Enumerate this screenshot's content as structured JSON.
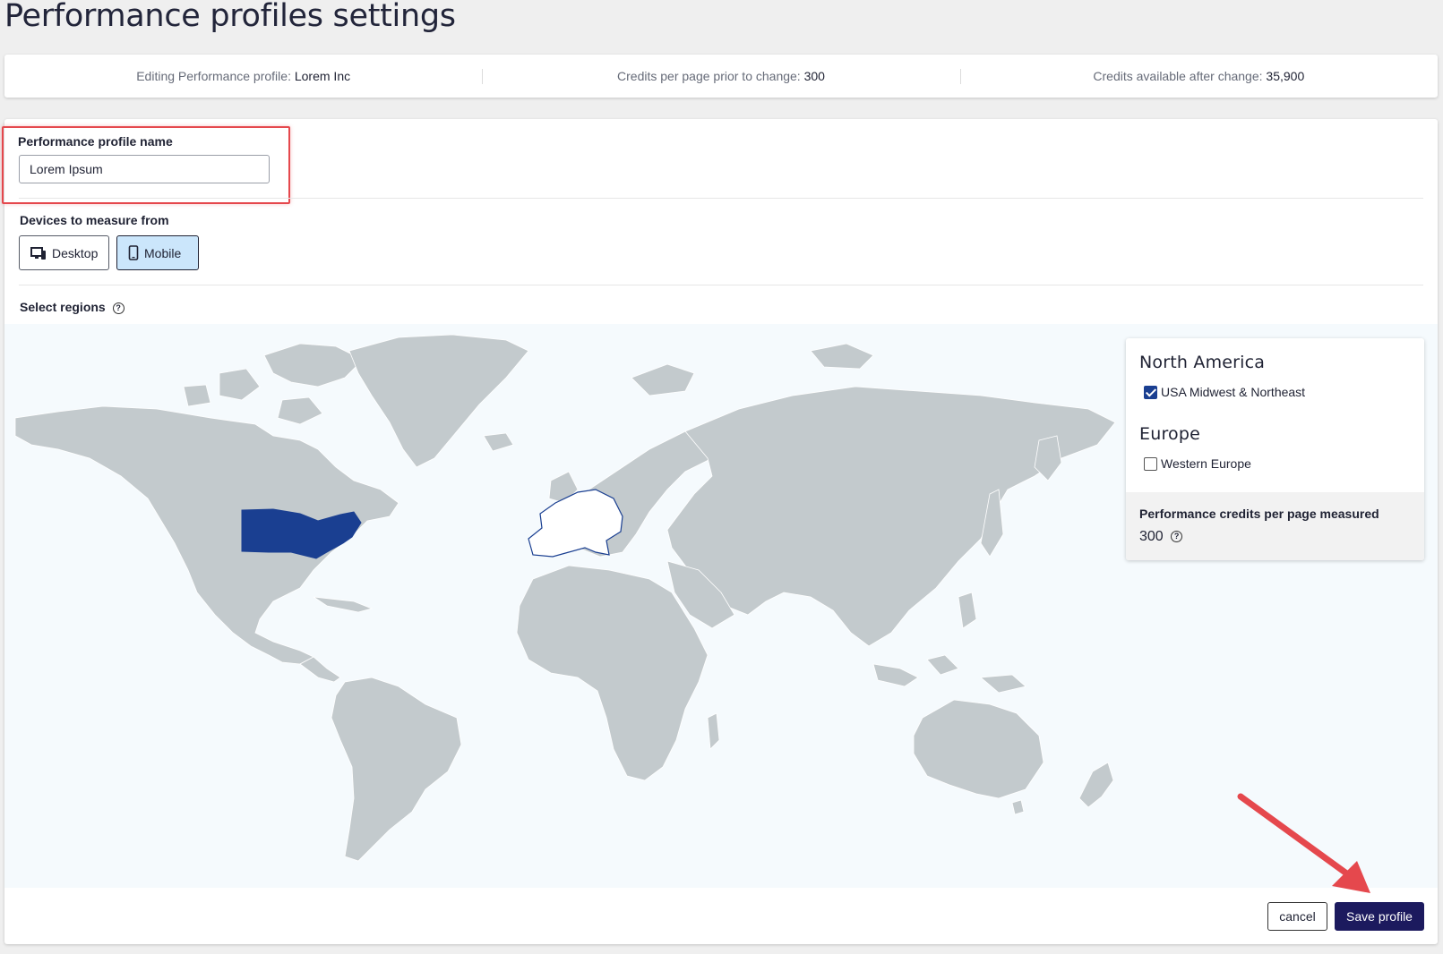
{
  "page": {
    "title": "Performance profiles settings"
  },
  "summary": {
    "editing_label": "Editing Performance profile:",
    "editing_value": "Lorem Inc",
    "credits_prior_label": "Credits per page prior to change:",
    "credits_prior_value": "300",
    "credits_after_label": "Credits available after change:",
    "credits_after_value": "35,900"
  },
  "profile": {
    "name_label": "Performance profile name",
    "name_value": "Lorem Ipsum"
  },
  "devices": {
    "label": "Devices to measure from",
    "desktop_label": "Desktop",
    "mobile_label": "Mobile",
    "selected": "Mobile"
  },
  "regions": {
    "label": "Select regions",
    "groups": [
      {
        "heading": "North America",
        "option": "USA Midwest & Northeast",
        "checked": true
      },
      {
        "heading": "Europe",
        "option": "Western Europe",
        "checked": false
      }
    ],
    "credits_label": "Performance credits per page measured",
    "credits_value": "300"
  },
  "actions": {
    "cancel_label": "cancel",
    "save_label": "Save profile"
  },
  "colors": {
    "primary": "#1c1a5e",
    "selected_region": "#1a3f91",
    "land": "#c3cacd",
    "device_selected_bg": "#cbe6fb",
    "annotation": "#e5484d"
  }
}
